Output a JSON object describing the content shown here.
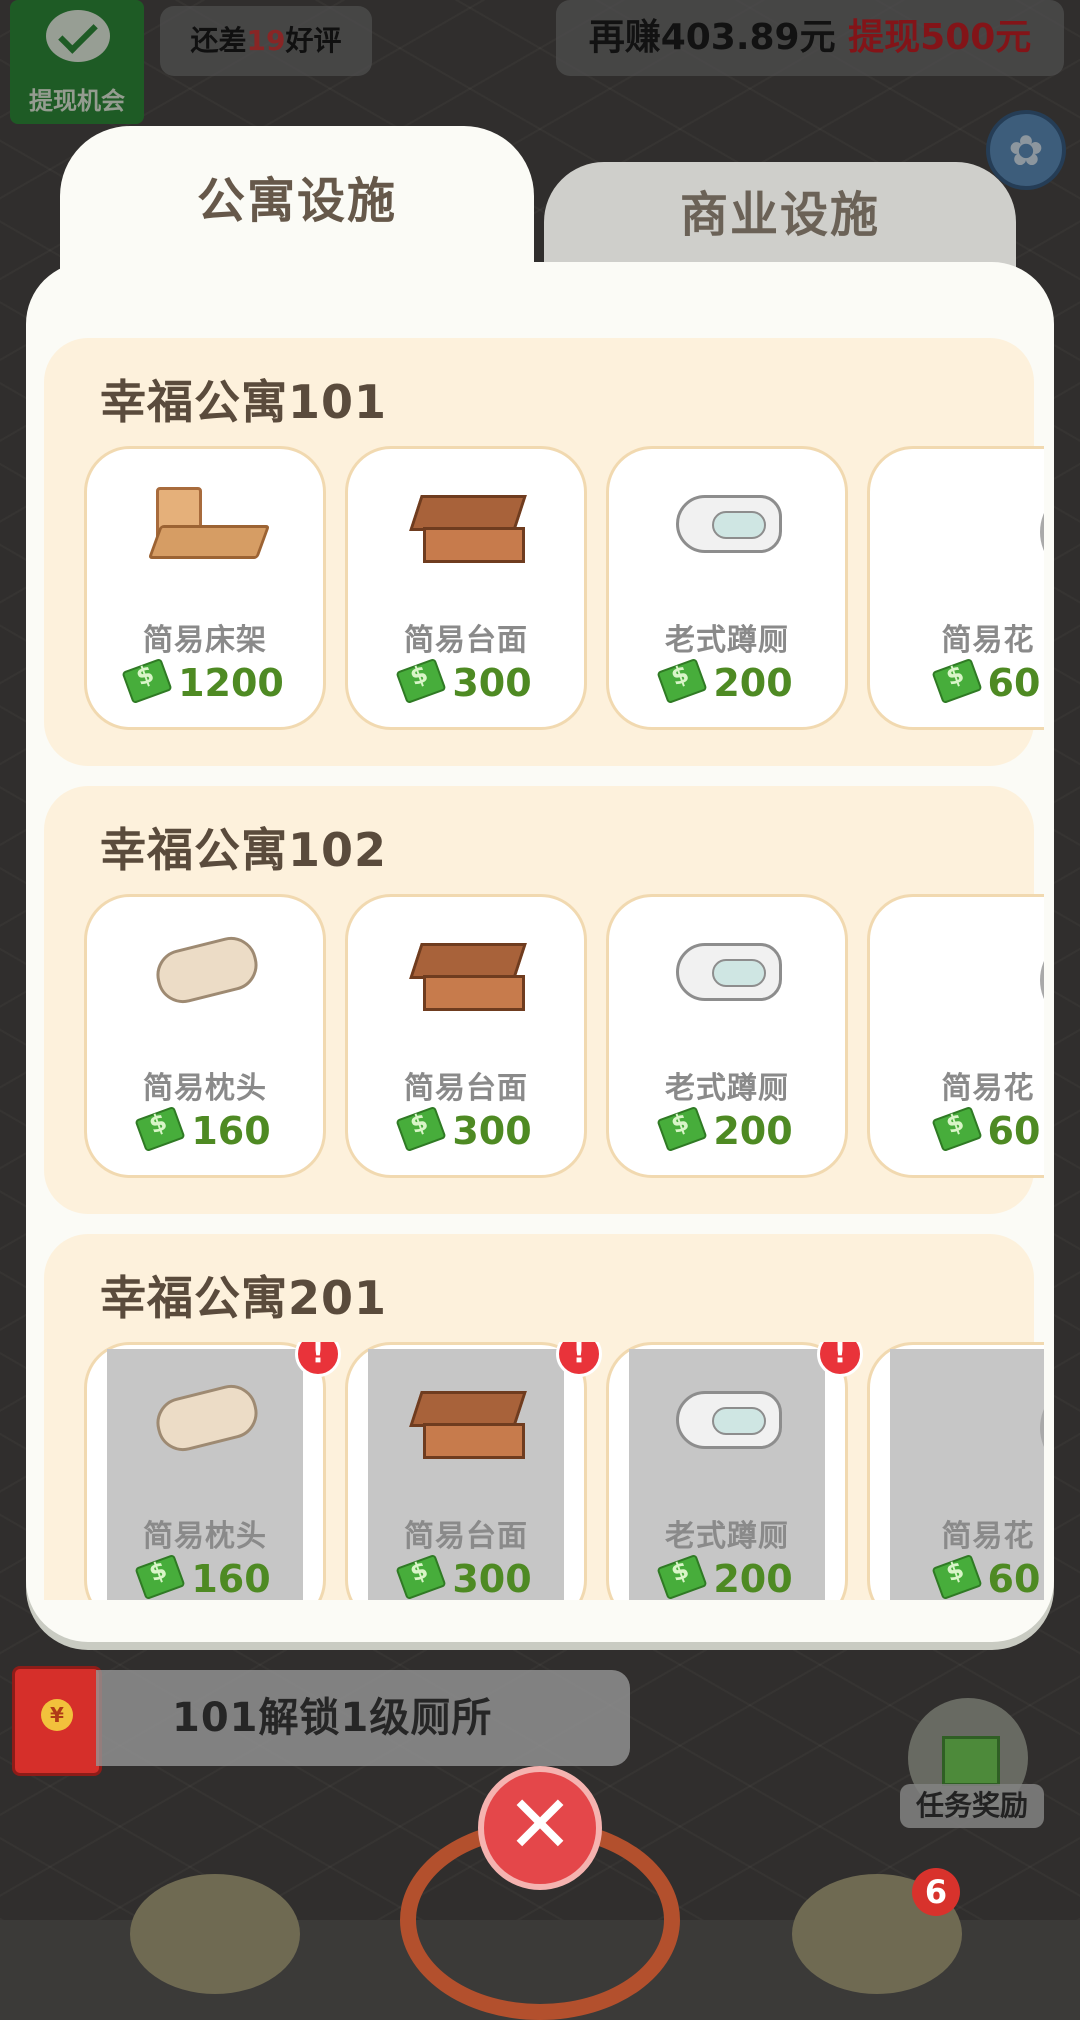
{
  "top_bar": {
    "wechat_label": "提现机会",
    "review": {
      "prefix": "还差",
      "count": "19",
      "suffix": "好评"
    },
    "earn": {
      "text": "再赚403.89元",
      "withdraw": "提现500元"
    }
  },
  "tabs": [
    {
      "label": "公寓设施",
      "active": true
    },
    {
      "label": "商业设施",
      "active": false
    }
  ],
  "sections": [
    {
      "title": "幸福公寓101",
      "items": [
        {
          "name": "简易床架",
          "price": "1200",
          "icon": "bed-frame-icon",
          "locked": false
        },
        {
          "name": "简易台面",
          "price": "300",
          "icon": "counter-icon",
          "locked": false
        },
        {
          "name": "老式蹲厕",
          "price": "200",
          "icon": "squat-toilet-icon",
          "locked": false
        },
        {
          "name": "简易花",
          "price": "60",
          "icon": "shower-pipe-icon",
          "locked": false
        }
      ]
    },
    {
      "title": "幸福公寓102",
      "items": [
        {
          "name": "简易枕头",
          "price": "160",
          "icon": "pillow-icon",
          "locked": false
        },
        {
          "name": "简易台面",
          "price": "300",
          "icon": "counter-icon",
          "locked": false
        },
        {
          "name": "老式蹲厕",
          "price": "200",
          "icon": "squat-toilet-icon",
          "locked": false
        },
        {
          "name": "简易花",
          "price": "60",
          "icon": "shower-pipe-icon",
          "locked": false
        }
      ]
    },
    {
      "title": "幸福公寓201",
      "items": [
        {
          "name": "简易枕头",
          "price": "160",
          "icon": "pillow-icon",
          "locked": true,
          "alert": "!"
        },
        {
          "name": "简易台面",
          "price": "300",
          "icon": "counter-icon",
          "locked": true,
          "alert": "!"
        },
        {
          "name": "老式蹲厕",
          "price": "200",
          "icon": "squat-toilet-icon",
          "locked": true,
          "alert": "!"
        },
        {
          "name": "简易花",
          "price": "60",
          "icon": "shower-pipe-icon",
          "locked": true
        }
      ]
    }
  ],
  "bottom": {
    "task_text": "101解锁1级厕所",
    "redpack_symbol": "¥",
    "reward_label": "任务奖励",
    "close_symbol": "✕",
    "badge_count": "6"
  }
}
